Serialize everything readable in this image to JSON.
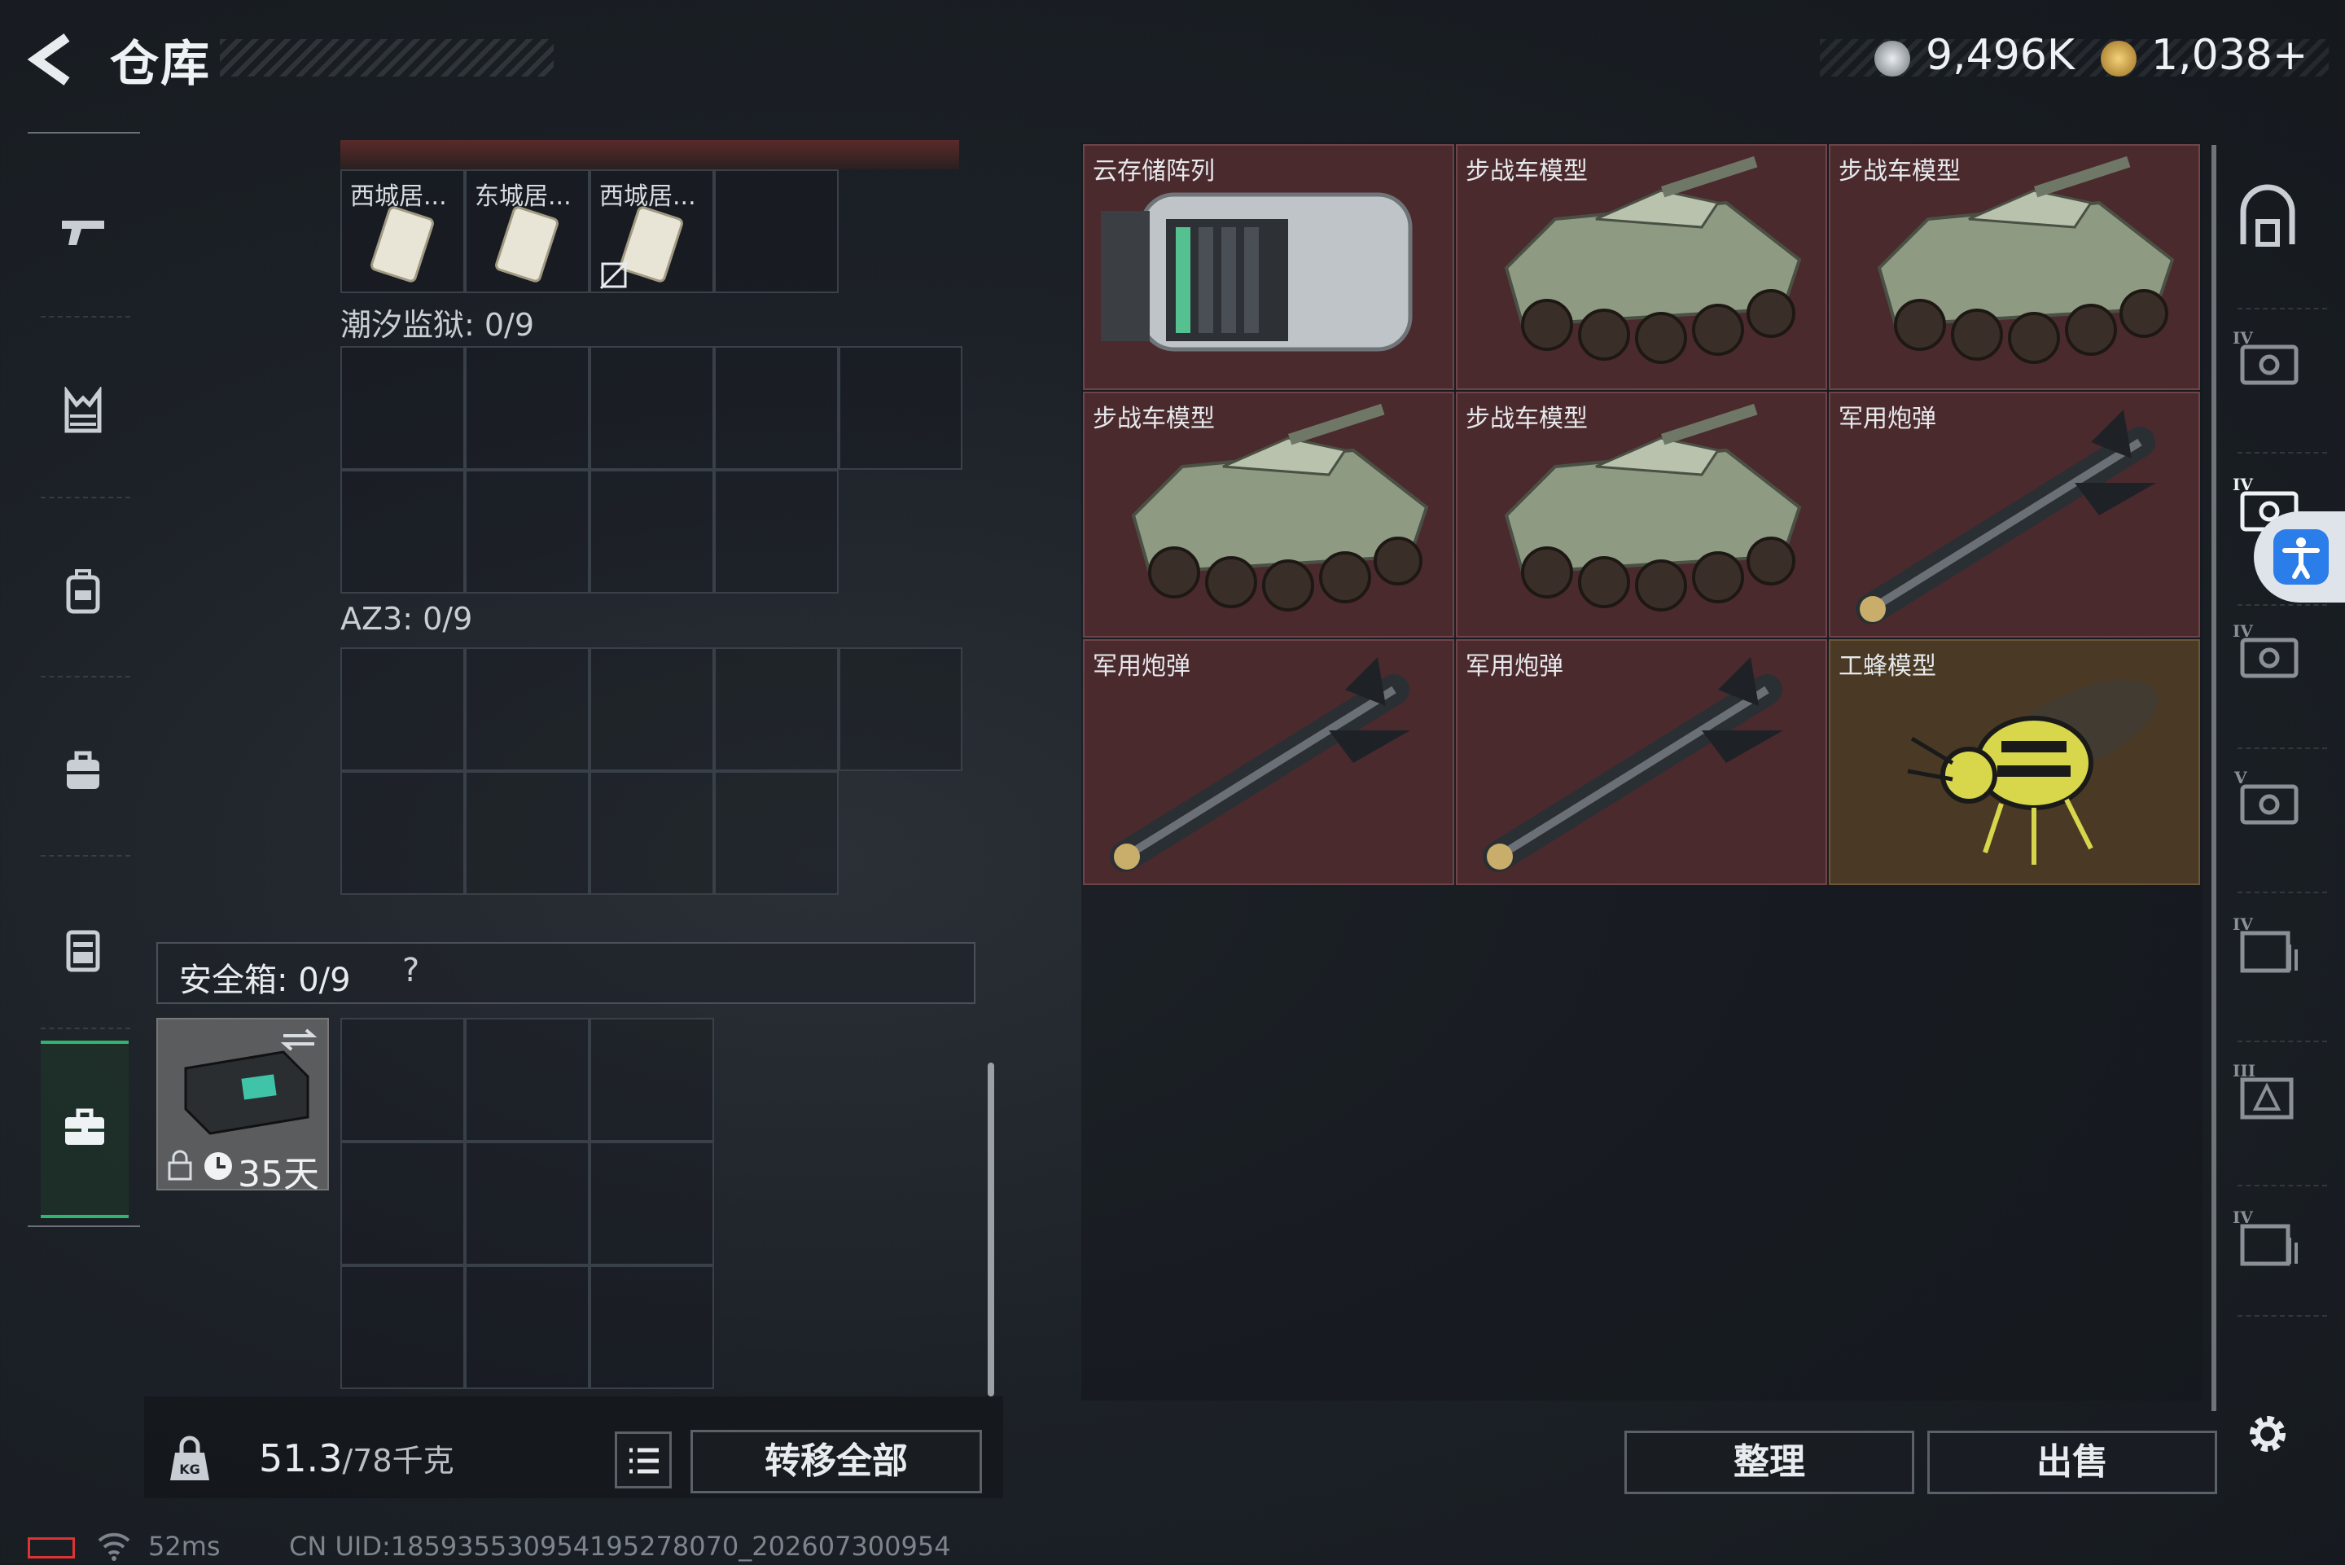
{
  "header": {
    "title": "仓库"
  },
  "currency": {
    "silver": "9,496K",
    "gold": "1,038+"
  },
  "loadout": {
    "top_items": [
      "西城居...",
      "东城居...",
      "西城居..."
    ],
    "sections": [
      {
        "label": "潮汐监狱: 0/9"
      },
      {
        "label": "AZ3: 0/9"
      }
    ],
    "safebox": {
      "label": "安全箱: 0/9",
      "help": "?",
      "duration": "35天"
    }
  },
  "bottom": {
    "weight_current": "51.3",
    "weight_max": "/78千克",
    "transfer_all": "转移全部",
    "organize": "整理",
    "sell": "出售"
  },
  "storage": {
    "items": [
      {
        "label": "云存储阵列",
        "icon": "server-array",
        "color": "#4b2a2e"
      },
      {
        "label": "步战车模型",
        "icon": "armored-vehicle",
        "color": "#4b2a2e"
      },
      {
        "label": "步战车模型",
        "icon": "armored-vehicle",
        "color": "#4b2a2e"
      },
      {
        "label": "步战车模型",
        "icon": "armored-vehicle",
        "color": "#4b2a2e"
      },
      {
        "label": "步战车模型",
        "icon": "armored-vehicle",
        "color": "#4b2a2e"
      },
      {
        "label": "军用炮弹",
        "icon": "missile",
        "color": "#4b2a2e"
      },
      {
        "label": "军用炮弹",
        "icon": "missile",
        "color": "#4b2a2e"
      },
      {
        "label": "军用炮弹",
        "icon": "missile",
        "color": "#4b2a2e"
      },
      {
        "label": "工蜂模型",
        "icon": "wasp",
        "color": "#4a3a25"
      }
    ]
  },
  "status": {
    "ping": "52ms",
    "uid": "CN UID:1859355309541952780​70_202607300954"
  }
}
